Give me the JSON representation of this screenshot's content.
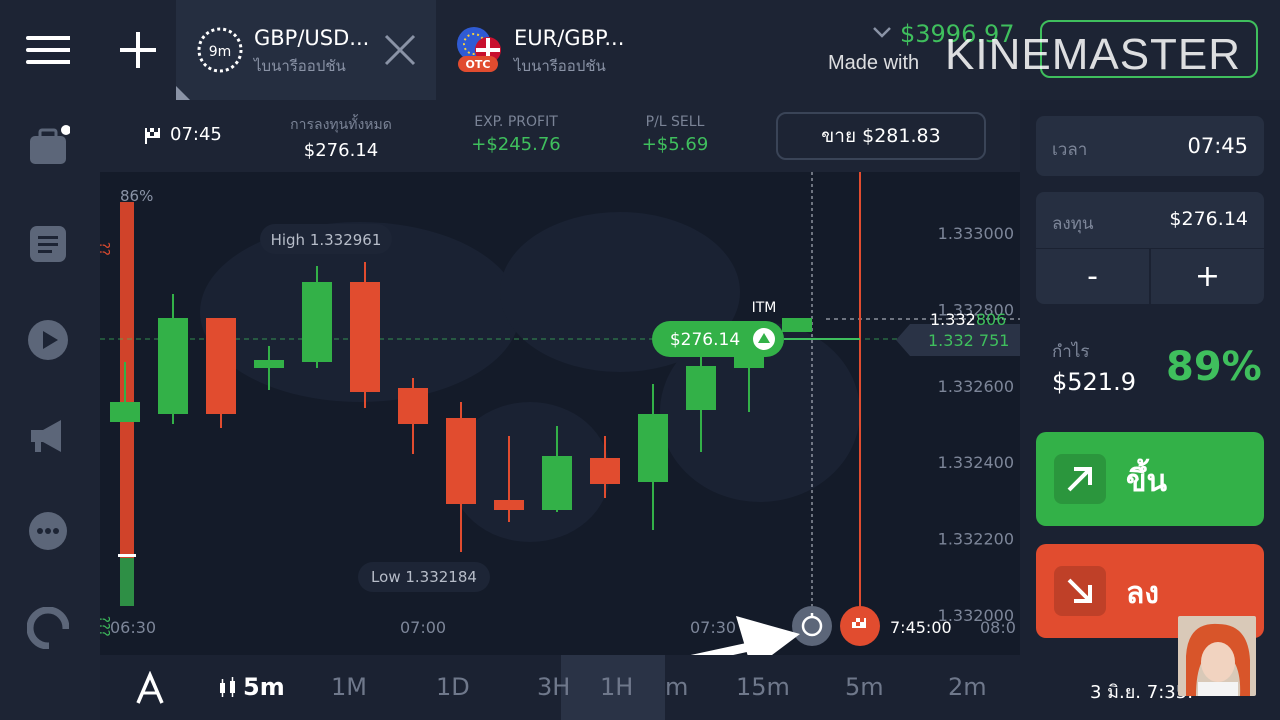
{
  "header": {
    "tabs": [
      {
        "title": "GBP/USD...",
        "subtitle": "ไบนารีออปชัน",
        "timer": "9m"
      },
      {
        "title": "EUR/GBP...",
        "subtitle": "ไบนารีออปชัน",
        "badge": "OTC"
      }
    ],
    "balance": "$3996.97",
    "watermark_made_with": "Made with",
    "watermark_brand": "KINEMASTER"
  },
  "info_strip": {
    "time": "07:45",
    "invest_label": "การลงทุนทั้งหมด",
    "invest_value": "$276.14",
    "exp_profit_label": "EXP. PROFIT",
    "exp_profit_value": "+$245.76",
    "pl_sell_label": "P/L SELL",
    "pl_sell_value": "+$5.69",
    "sell_button": "ขาย $281.83"
  },
  "chart": {
    "sentiment_top": "86%",
    "high_label": "High 1.332961",
    "low_label": "Low 1.332184",
    "price_tag": "$276.14",
    "itm_label": "ITM",
    "current_price_a": "1.332",
    "current_price_a_suffix": "806",
    "current_price_b": "1.332 751",
    "y_ticks": [
      "1.333000",
      "1.332800",
      "1.332600",
      "1.332400",
      "1.332200",
      "1.332000"
    ],
    "x_ticks": [
      "06:30",
      "07:00",
      "07:30",
      "08:0"
    ],
    "expiry_time": "7:45:00",
    "left_marks_top": "??",
    "left_marks_bottom": "???"
  },
  "right_panel": {
    "time_label": "เวลา",
    "time_value": "07:45",
    "invest_label": "ลงทุน",
    "invest_value": "$276.14",
    "minus": "-",
    "plus": "+",
    "profit_label": "กำไร",
    "profit_value": "$521.9",
    "profit_pct": "89%",
    "up_label": "ขึ้น",
    "down_label": "ลง"
  },
  "bottom_bar": {
    "chart_timeframe": "5m",
    "timeframes": [
      "1M",
      "1D",
      "3H",
      "1H",
      "m",
      "15m",
      "5m",
      "2m"
    ],
    "datetime": "3 มิ.ย. 7:35:"
  },
  "colors": {
    "green": "#33b148",
    "red": "#e14c2f",
    "background": "#141b29"
  }
}
